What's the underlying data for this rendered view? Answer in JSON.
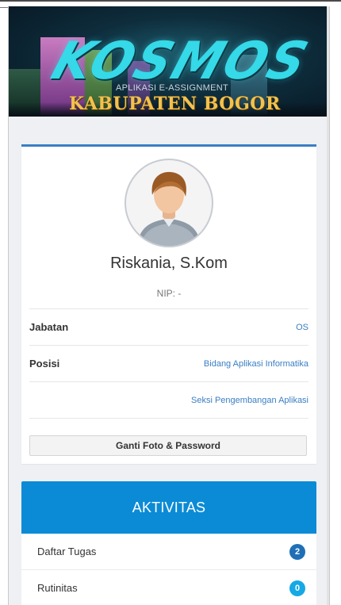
{
  "banner": {
    "logo": "KOSMOS",
    "subtitle": "APLIKASI E-ASSIGNMENT",
    "region": "KABUPATEN BOGOR"
  },
  "profile": {
    "name": "Riskania, S.Kom",
    "nip": "NIP: -",
    "fields": [
      {
        "label": "Jabatan",
        "value": "OS"
      },
      {
        "label": "Posisi",
        "value": "Bidang Aplikasi Informatika"
      },
      {
        "label": "",
        "value": "Seksi Pengembangan Aplikasi"
      }
    ],
    "button_label": "Ganti Foto & Password"
  },
  "activity": {
    "title": "AKTIVITAS",
    "items": [
      {
        "label": "Daftar Tugas",
        "count": "2",
        "color": "#1f6fb6"
      },
      {
        "label": "Rutinitas",
        "count": "0",
        "color": "#17a8e6"
      }
    ]
  },
  "colors": {
    "accent": "#3a7ec3",
    "header_blue": "#0b8bd6"
  }
}
